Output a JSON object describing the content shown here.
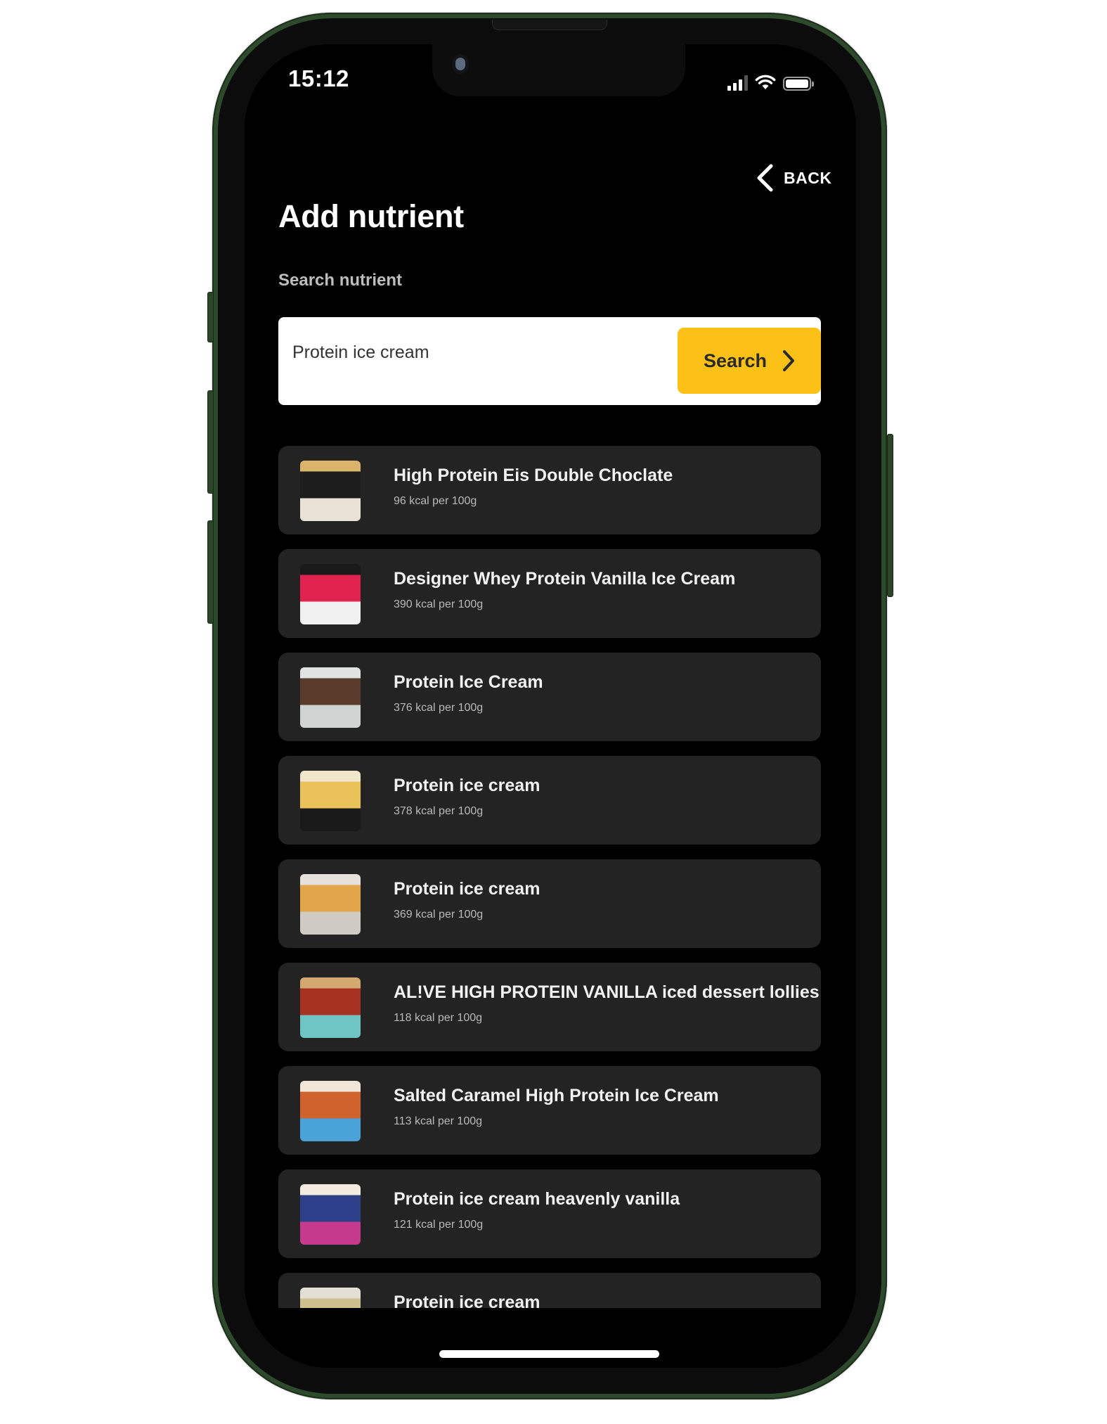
{
  "status_bar": {
    "time": "15:12",
    "icons": [
      "cellular-signal-icon",
      "wifi-icon",
      "battery-icon"
    ]
  },
  "header": {
    "back_label": "BACK",
    "back_icon": "chevron-left-icon",
    "title": "Add nutrient"
  },
  "search": {
    "label": "Search nutrient",
    "value": "Protein ice cream",
    "button_label": "Search",
    "button_icon": "chevron-right-icon",
    "accent_color": "#fbc116"
  },
  "results": [
    {
      "title": "High Protein Eis Double Choclate",
      "subtitle": "96 kcal per 100g",
      "thumb": {
        "colors": [
          "#d9b46a",
          "#1d1d1d",
          "#e8e3d6"
        ]
      }
    },
    {
      "title": "Designer Whey Protein Vanilla Ice Cream",
      "subtitle": "390 kcal per 100g",
      "thumb": {
        "colors": [
          "#1a1a1a",
          "#e0234e",
          "#f0f0f0"
        ]
      }
    },
    {
      "title": "Protein Ice Cream",
      "subtitle": "376 kcal per 100g",
      "thumb": {
        "colors": [
          "#dfe3e1",
          "#5a3a2a",
          "#cfd4d2"
        ]
      }
    },
    {
      "title": "Protein ice cream",
      "subtitle": "378 kcal per 100g",
      "thumb": {
        "colors": [
          "#efe6cc",
          "#e9c25a",
          "#1a1a1a"
        ]
      }
    },
    {
      "title": "Protein ice cream",
      "subtitle": "369 kcal per 100g",
      "thumb": {
        "colors": [
          "#e6e2db",
          "#e3a54a",
          "#cfcac2"
        ]
      }
    },
    {
      "title": "AL!VE HIGH PROTEIN VANILLA iced dessert lollies",
      "subtitle": "118 kcal per 100g",
      "thumb": {
        "colors": [
          "#d4a970",
          "#a83222",
          "#6fc4c4"
        ]
      }
    },
    {
      "title": "Salted Caramel High Protein Ice Cream",
      "subtitle": "113 kcal per 100g",
      "thumb": {
        "colors": [
          "#f1e7d8",
          "#d0622e",
          "#4aa3d8"
        ]
      }
    },
    {
      "title": "Protein ice cream heavenly vanilla",
      "subtitle": "121 kcal per 100g",
      "thumb": {
        "colors": [
          "#f3ecde",
          "#2e3f8a",
          "#c63a8e"
        ]
      }
    },
    {
      "title": "Protein ice cream",
      "subtitle": "",
      "thumb": {
        "colors": [
          "#e4dfd4",
          "#cdbf8e",
          "#333333"
        ]
      }
    }
  ]
}
